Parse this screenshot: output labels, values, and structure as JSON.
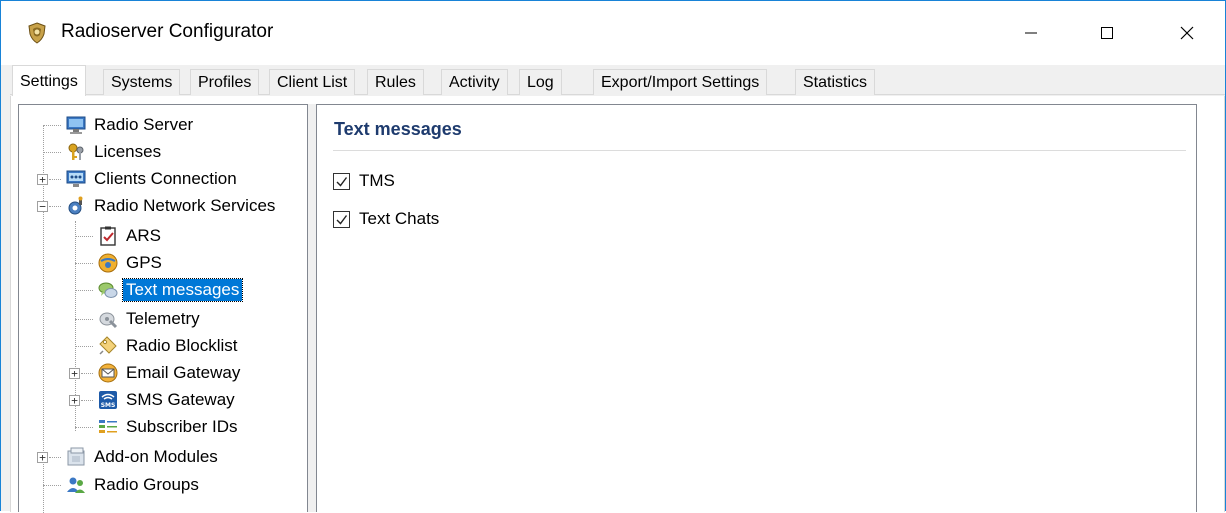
{
  "window": {
    "title": "Radioserver Configurator"
  },
  "tabs": [
    {
      "label": "Settings",
      "active": true
    },
    {
      "label": "Systems"
    },
    {
      "label": "Profiles"
    },
    {
      "label": "Client List"
    },
    {
      "label": "Rules"
    },
    {
      "label": "Activity"
    },
    {
      "label": "Log"
    },
    {
      "label": "Export/Import Settings"
    },
    {
      "label": "Statistics"
    }
  ],
  "tree": {
    "items": [
      {
        "label": "Radio Server",
        "icon": "monitor-icon"
      },
      {
        "label": "Licenses",
        "icon": "keys-icon"
      },
      {
        "label": "Clients Connection",
        "icon": "network-icon"
      },
      {
        "label": "Radio Network Services",
        "icon": "gear-icon"
      },
      {
        "label": "ARS",
        "icon": "clipboard-check-icon"
      },
      {
        "label": "GPS",
        "icon": "globe-icon"
      },
      {
        "label": "Text messages",
        "icon": "chat-bubbles-icon",
        "selected": true
      },
      {
        "label": "Telemetry",
        "icon": "telemetry-icon"
      },
      {
        "label": "Radio Blocklist",
        "icon": "tag-icon"
      },
      {
        "label": "Email Gateway",
        "icon": "envelope-icon"
      },
      {
        "label": "SMS Gateway",
        "icon": "sms-icon"
      },
      {
        "label": "Subscriber IDs",
        "icon": "list-icon"
      },
      {
        "label": "Add-on Modules",
        "icon": "modules-icon"
      },
      {
        "label": "Radio Groups",
        "icon": "users-icon"
      }
    ]
  },
  "details": {
    "title": "Text messages",
    "options": [
      {
        "label": "TMS",
        "checked": true
      },
      {
        "label": "Text Chats",
        "checked": true
      }
    ]
  },
  "colors": {
    "accent": "#0078d7",
    "window_border": "#1883d7",
    "section_title": "#1e3b6e"
  }
}
